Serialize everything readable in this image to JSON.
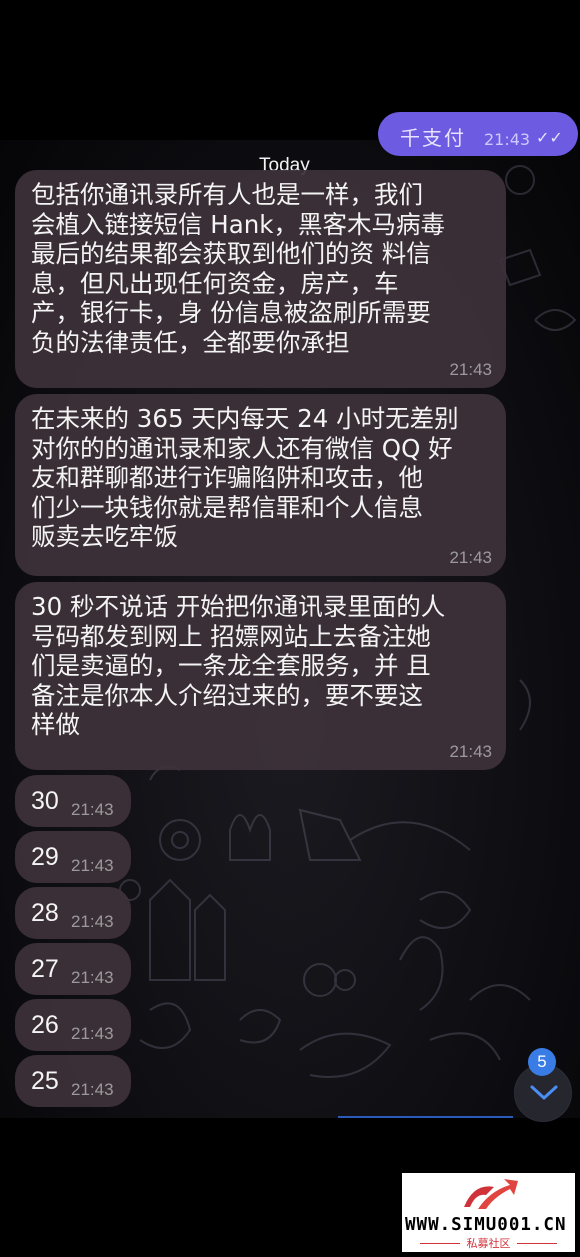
{
  "top_outgoing": {
    "text": "千支付",
    "time": "21:43",
    "status": "✓✓"
  },
  "date_divider": "Today",
  "messages": [
    {
      "text": "包括你通讯录所有人也是一样，我们\n会植入链接短信 Hank，黑客木马病毒\n最后的结果都会获取到他们的资 料信\n息，但凡出现任何资金，房产，车\n产，银行卡，身 份信息被盗刷所需要\n负的法律责任，全都要你承担",
      "time": "21:43"
    },
    {
      "text": "在未来的 365 天内每天 24 小时无差别\n对你的的通讯录和家人还有微信 QQ 好\n友和群聊都进行诈骗陷阱和攻击，他\n们少一块钱你就是帮信罪和个人信息\n贩卖去吃牢饭",
      "time": "21:43"
    },
    {
      "text": "30 秒不说话 开始把你通讯录里面的人\n号码都发到网上 招嫖网站上去备注她\n们是卖逼的，一条龙全套服务，并 且\n备注是你本人介绍过来的，要不要这\n样做",
      "time": "21:43"
    }
  ],
  "countdown": [
    {
      "text": "30",
      "time": "21:43"
    },
    {
      "text": "29",
      "time": "21:43"
    },
    {
      "text": "28",
      "time": "21:43"
    },
    {
      "text": "27",
      "time": "21:43"
    },
    {
      "text": "26",
      "time": "21:43"
    },
    {
      "text": "25",
      "time": "21:43"
    }
  ],
  "unread_badge": "5",
  "scroll_button_icon": "chevron-down-icon",
  "watermark": {
    "url": "WWW.SIMU001.CN",
    "subtitle": "私募社区"
  },
  "colors": {
    "incoming_bubble": "#3e323a",
    "outgoing_bubble": "#6d5be2",
    "badge": "#3a7ce6",
    "watermark_red": "#d0323a"
  }
}
